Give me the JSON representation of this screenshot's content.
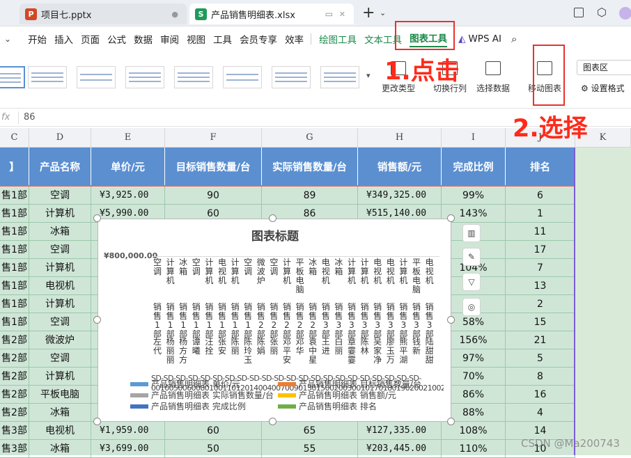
{
  "tabs": [
    {
      "label": "项目七.pptx",
      "icon": "P",
      "icon_color": "#d24726"
    },
    {
      "label": "产品销售明细表.xlsx",
      "icon": "S",
      "icon_color": "#1f9a5a"
    }
  ],
  "menu": [
    "开始",
    "插入",
    "页面",
    "公式",
    "数据",
    "审阅",
    "视图",
    "工具",
    "会员专享",
    "效率",
    "绘图工具",
    "文本工具",
    "图表工具",
    "WPS AI"
  ],
  "ribbon": {
    "change_type": "更改类型",
    "switch_row_col": "切换行列",
    "select_data": "选择数据",
    "move_chart": "移动图表",
    "chart_area": "图表区",
    "set_format": "设置格式"
  },
  "formula": {
    "fx": "fx",
    "value": "86"
  },
  "columns": [
    "C",
    "D",
    "E",
    "F",
    "G",
    "H",
    "I",
    "J",
    "K"
  ],
  "headers": [
    "】",
    "产品名称",
    "单价/元",
    "目标销售数量/台",
    "实际销售数量/台",
    "销售额/元",
    "完成比例",
    "排名"
  ],
  "rows": [
    [
      "售1部",
      "空调",
      "¥3,925.00",
      "90",
      "89",
      "¥349,325.00",
      "99%",
      "6"
    ],
    [
      "售1部",
      "计算机",
      "¥5,990.00",
      "60",
      "86",
      "¥515,140.00",
      "143%",
      "1"
    ],
    [
      "售1部",
      "冰箱",
      "",
      "",
      "",
      "",
      "",
      "11"
    ],
    [
      "售1部",
      "空调",
      "",
      "",
      "",
      "",
      "",
      "17"
    ],
    [
      "售1部",
      "计算机",
      "",
      "",
      "",
      "",
      "104%",
      "7"
    ],
    [
      "售1部",
      "电视机",
      "",
      "",
      "",
      "",
      "",
      "13"
    ],
    [
      "售1部",
      "计算机",
      "",
      "",
      "",
      "",
      "",
      "2"
    ],
    [
      "售1部",
      "空调",
      "",
      "",
      "",
      "",
      "58%",
      "15"
    ],
    [
      "售2部",
      "微波炉",
      "",
      "",
      "",
      "",
      "156%",
      "21"
    ],
    [
      "售2部",
      "空调",
      "",
      "",
      "",
      "",
      "97%",
      "5"
    ],
    [
      "售2部",
      "计算机",
      "",
      "",
      "",
      "",
      "70%",
      "8"
    ],
    [
      "售2部",
      "平板电脑",
      "",
      "",
      "",
      "",
      "86%",
      "16"
    ],
    [
      "售2部",
      "冰箱",
      "",
      "",
      "",
      "",
      "88%",
      "4"
    ],
    [
      "售3部",
      "电视机",
      "¥1,959.00",
      "60",
      "65",
      "¥127,335.00",
      "108%",
      "14"
    ],
    [
      "售3部",
      "冰箱",
      "¥3,699.00",
      "50",
      "55",
      "¥203,445.00",
      "110%",
      "10"
    ]
  ],
  "chart": {
    "title": "图表标题",
    "y_top": "¥800,000.00",
    "products": [
      "空调",
      "计算机",
      "冰箱",
      "空调",
      "计算机",
      "电视机",
      "计算机",
      "空调",
      "微波炉",
      "空调",
      "计算机",
      "平板电脑",
      "冰箱",
      "电视机",
      "冰箱",
      "计算机",
      "计算机",
      "电视机",
      "电视机",
      "计算机",
      "平板电脑",
      "电视机"
    ],
    "depts": [
      "销售1部",
      "销售1部",
      "销售1部",
      "销售1部",
      "销售1部",
      "销售1部",
      "销售1部",
      "销售1部",
      "销售2部",
      "销售2部",
      "销售2部",
      "销售2部",
      "销售2部",
      "销售3部",
      "销售3部",
      "销售3部",
      "销售3部",
      "销售3部",
      "销售3部",
      "销售3部",
      "销售3部",
      "销售3部"
    ],
    "names": [
      "左代",
      "杨丽丽",
      "杨方方",
      "谭曦",
      "汪拴",
      "张安",
      "陈丽",
      "陈玲玉",
      "陈娟",
      "张丽",
      "邓平安",
      "邓华",
      "袁中星",
      "王进",
      "白丽",
      "章霎霎",
      "陈林",
      "吴家净",
      "廖玉万",
      "熊平湖",
      "钱新",
      "陆甜甜"
    ],
    "ids": "SD-SD-SD-SD-SD-SD-SD-SD-SD-SD-SD-SD-SD-SD-SD-SD-SD-SD-SD-SD-SD-SD-",
    "id_nums": "0010050060080100110120140040070090130150020030010170180190200210022",
    "legend": [
      {
        "label": "产品销售明细表 单价/元",
        "color": "#5b9bd5"
      },
      {
        "label": "产品销售明细表 目标销售数量/台",
        "color": "#ed7d31"
      },
      {
        "label": "产品销售明细表 实际销售数量/台",
        "color": "#a5a5a5"
      },
      {
        "label": "产品销售明细表 销售额/元",
        "color": "#ffc000"
      },
      {
        "label": "产品销售明细表 完成比例",
        "color": "#4472c4"
      },
      {
        "label": "产品销售明细表 排名",
        "color": "#70ad47"
      }
    ]
  },
  "annotations": {
    "step1": "1.点击",
    "step2": "2.选择"
  },
  "watermark": "CSDN @Ma200743"
}
